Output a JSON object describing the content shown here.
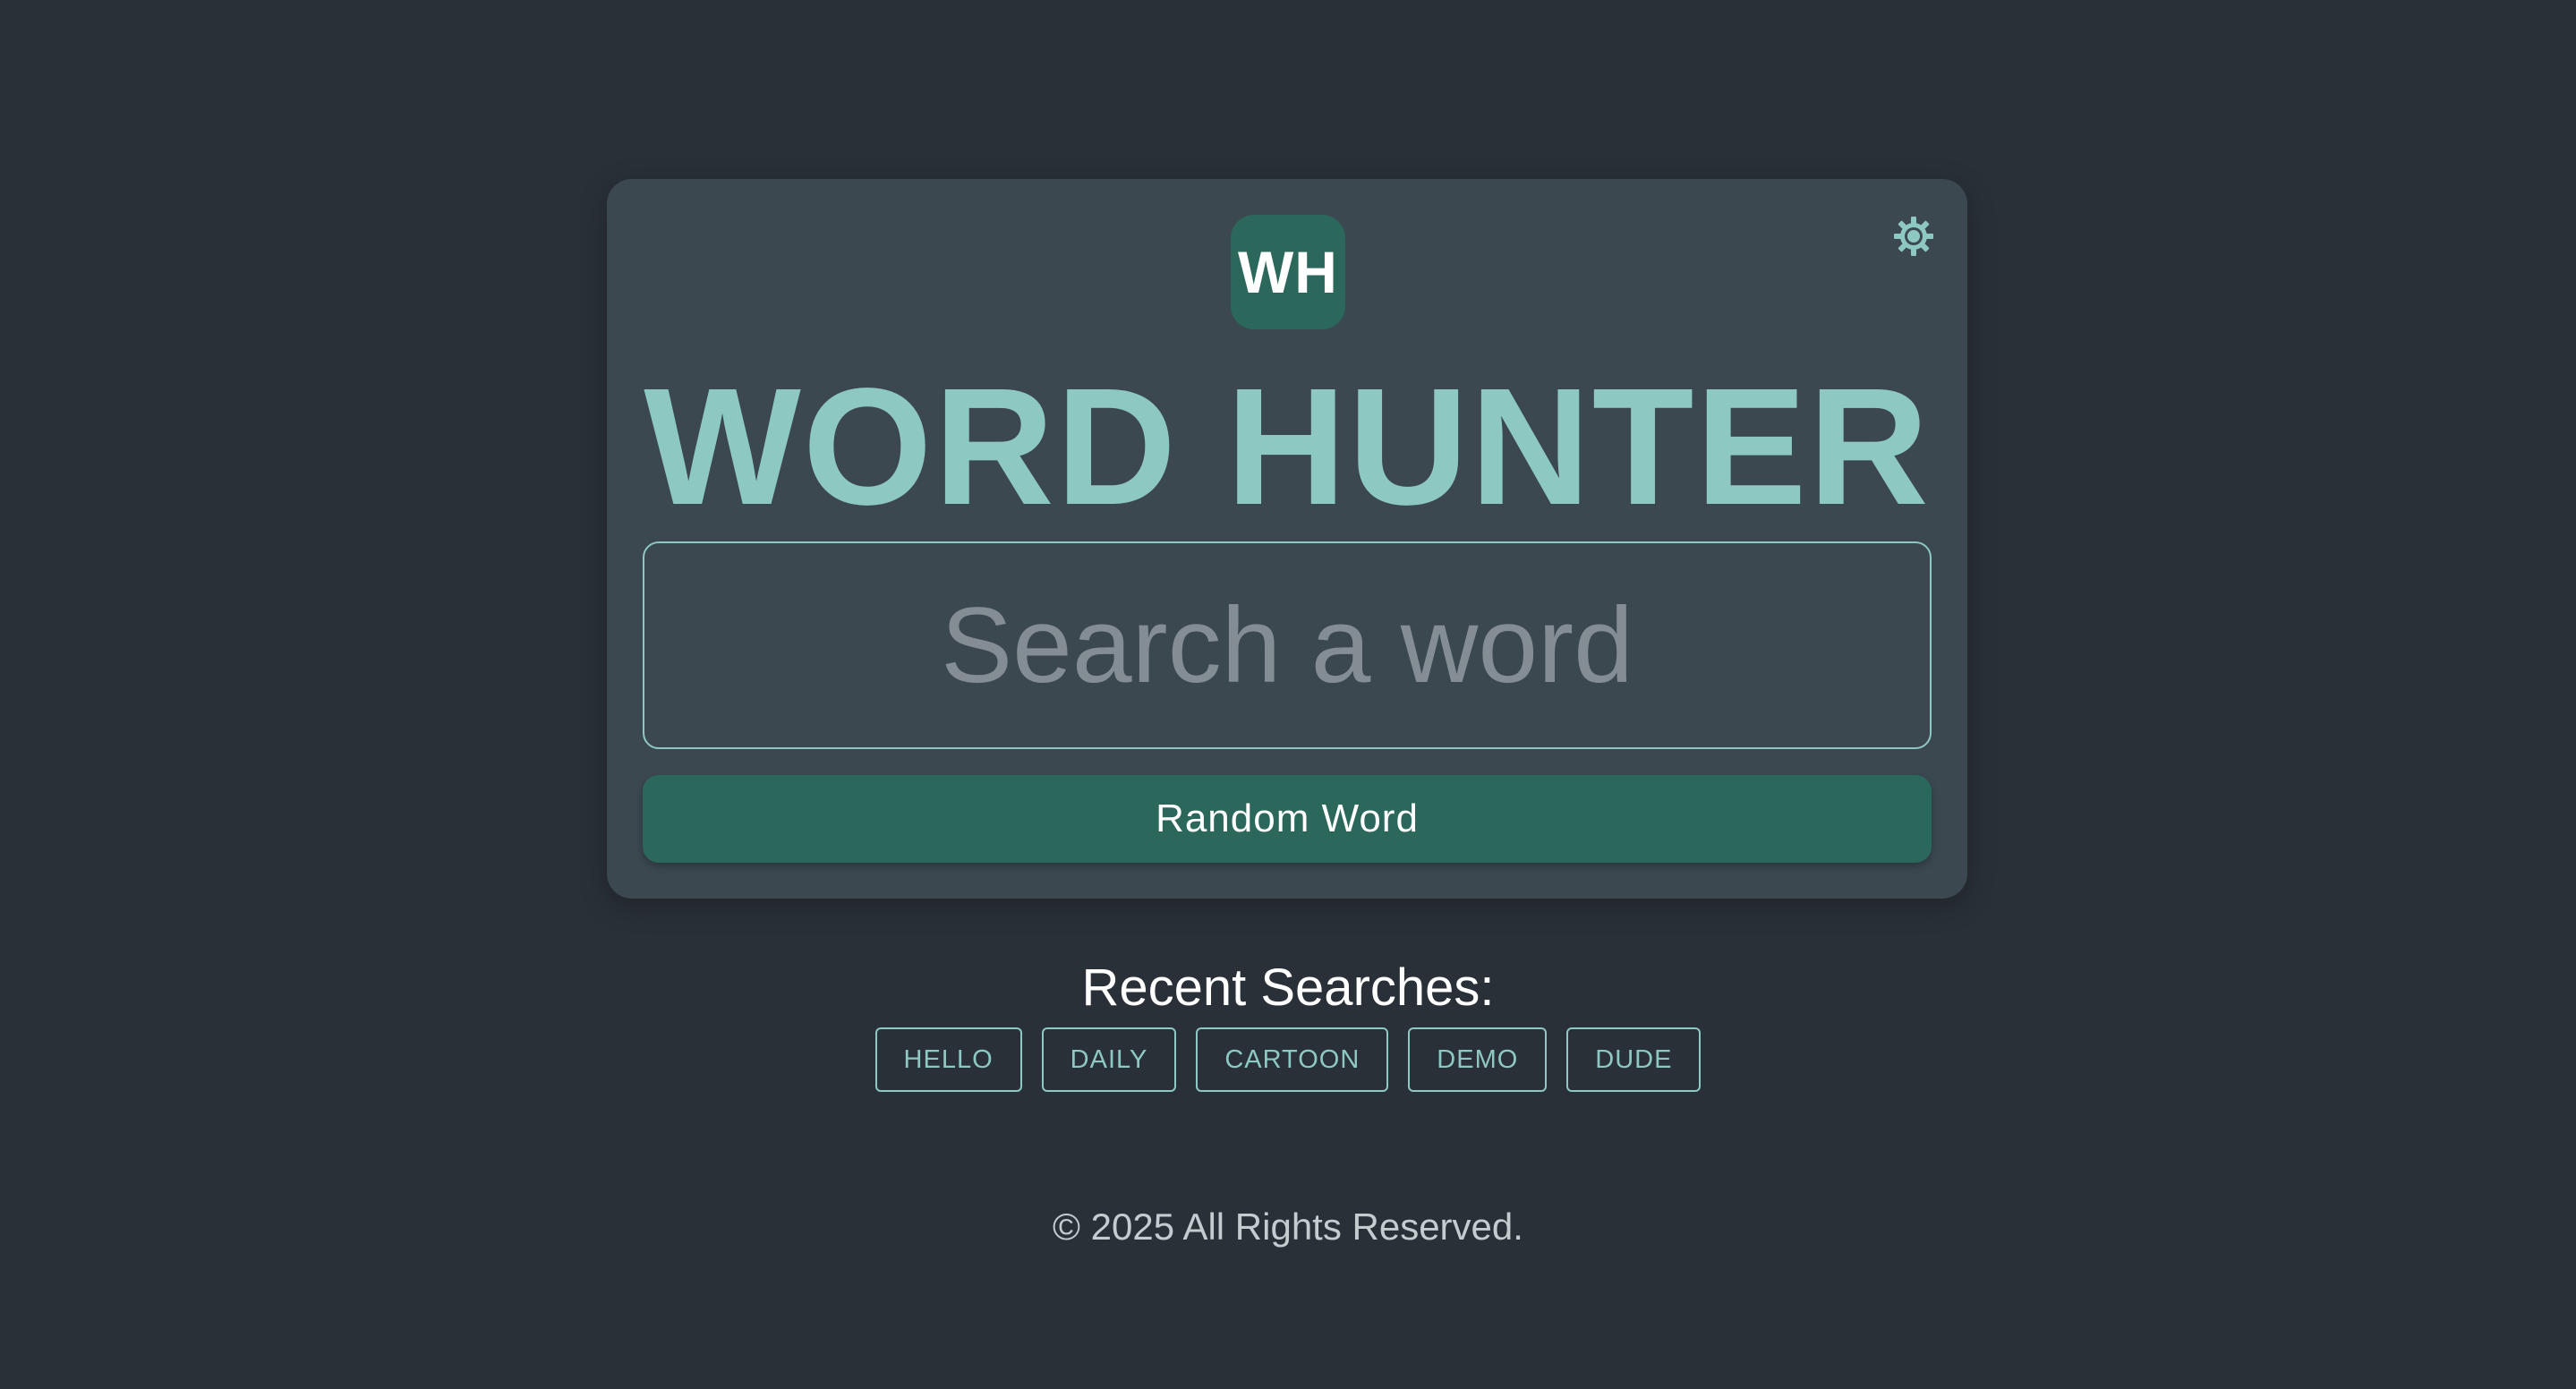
{
  "app": {
    "logo_text": "WH",
    "title": "WORD HUNTER",
    "theme_toggle_icon": "sun-icon"
  },
  "search": {
    "placeholder": "Search a word",
    "value": ""
  },
  "random_button": {
    "label": "Random Word"
  },
  "recent": {
    "heading": "Recent Searches:",
    "items": [
      {
        "label": "HELLO"
      },
      {
        "label": "DAILY"
      },
      {
        "label": "CARTOON"
      },
      {
        "label": "DEMO"
      },
      {
        "label": "DUDE"
      }
    ]
  },
  "footer": {
    "text": "© 2025 All Rights Reserved."
  },
  "colors": {
    "background": "#293037",
    "card": "#3b4850",
    "accent": "#8ec8c2",
    "primary": "#2c675c"
  }
}
